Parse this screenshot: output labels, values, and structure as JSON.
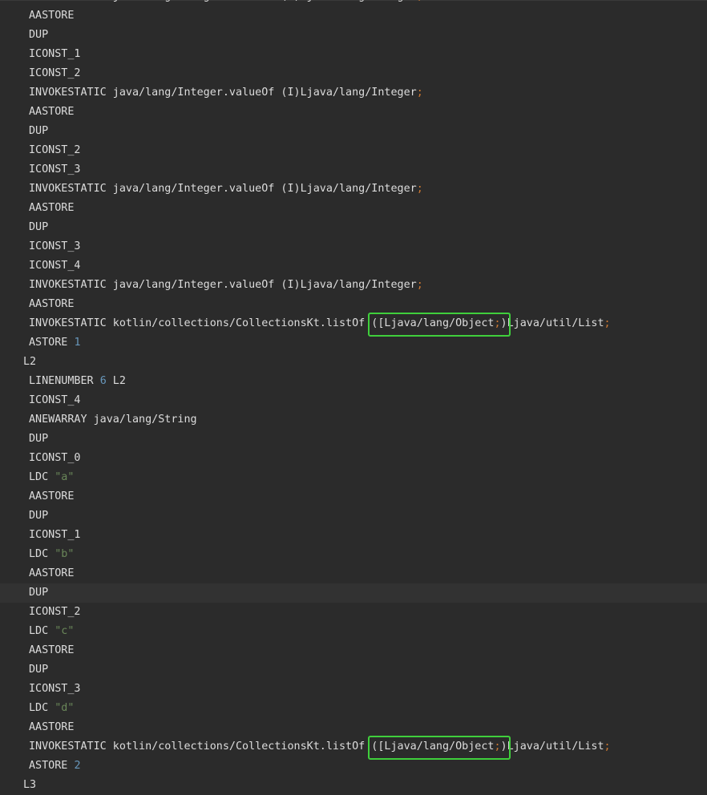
{
  "colors": {
    "background": "#2b2b2b",
    "text": "#dcdcdc",
    "number": "#6897bb",
    "string": "#6a8759",
    "semicolon": "#cc7832",
    "highlight_box": "#3fcf3c",
    "current_line": "#323232"
  },
  "code": {
    "lines": [
      {
        "kind": "insn",
        "tokens": [
          {
            "t": "plain",
            "v": "INVOKESTATIC java/lang/Integer.valueOf (I)Ljava/lang/Integer"
          },
          {
            "t": "semi",
            "v": ";"
          }
        ]
      },
      {
        "kind": "insn",
        "tokens": [
          {
            "t": "plain",
            "v": "AASTORE"
          }
        ]
      },
      {
        "kind": "insn",
        "tokens": [
          {
            "t": "plain",
            "v": "DUP"
          }
        ]
      },
      {
        "kind": "insn",
        "tokens": [
          {
            "t": "plain",
            "v": "ICONST_1"
          }
        ]
      },
      {
        "kind": "insn",
        "tokens": [
          {
            "t": "plain",
            "v": "ICONST_2"
          }
        ]
      },
      {
        "kind": "insn",
        "tokens": [
          {
            "t": "plain",
            "v": "INVOKESTATIC java/lang/Integer.valueOf (I)Ljava/lang/Integer"
          },
          {
            "t": "semi",
            "v": ";"
          }
        ]
      },
      {
        "kind": "insn",
        "tokens": [
          {
            "t": "plain",
            "v": "AASTORE"
          }
        ]
      },
      {
        "kind": "insn",
        "tokens": [
          {
            "t": "plain",
            "v": "DUP"
          }
        ]
      },
      {
        "kind": "insn",
        "tokens": [
          {
            "t": "plain",
            "v": "ICONST_2"
          }
        ]
      },
      {
        "kind": "insn",
        "tokens": [
          {
            "t": "plain",
            "v": "ICONST_3"
          }
        ]
      },
      {
        "kind": "insn",
        "tokens": [
          {
            "t": "plain",
            "v": "INVOKESTATIC java/lang/Integer.valueOf (I)Ljava/lang/Integer"
          },
          {
            "t": "semi",
            "v": ";"
          }
        ]
      },
      {
        "kind": "insn",
        "tokens": [
          {
            "t": "plain",
            "v": "AASTORE"
          }
        ]
      },
      {
        "kind": "insn",
        "tokens": [
          {
            "t": "plain",
            "v": "DUP"
          }
        ]
      },
      {
        "kind": "insn",
        "tokens": [
          {
            "t": "plain",
            "v": "ICONST_3"
          }
        ]
      },
      {
        "kind": "insn",
        "tokens": [
          {
            "t": "plain",
            "v": "ICONST_4"
          }
        ]
      },
      {
        "kind": "insn",
        "tokens": [
          {
            "t": "plain",
            "v": "INVOKESTATIC java/lang/Integer.valueOf (I)Ljava/lang/Integer"
          },
          {
            "t": "semi",
            "v": ";"
          }
        ]
      },
      {
        "kind": "insn",
        "tokens": [
          {
            "t": "plain",
            "v": "AASTORE"
          }
        ]
      },
      {
        "kind": "insn",
        "highlight": true,
        "tokens": [
          {
            "t": "plain",
            "v": "INVOKESTATIC kotlin/collections/CollectionsKt.listOf "
          },
          {
            "t": "boxstart",
            "v": "([Ljava/lang/Object"
          },
          {
            "t": "semi",
            "v": ";"
          },
          {
            "t": "boxend",
            "v": ")"
          },
          {
            "t": "plain",
            "v": "Ljava/util/List"
          },
          {
            "t": "semi",
            "v": ";"
          }
        ]
      },
      {
        "kind": "insn",
        "tokens": [
          {
            "t": "plain",
            "v": "ASTORE "
          },
          {
            "t": "num",
            "v": "1"
          }
        ]
      },
      {
        "kind": "label",
        "tokens": [
          {
            "t": "plain",
            "v": "L2"
          }
        ]
      },
      {
        "kind": "insn",
        "tokens": [
          {
            "t": "plain",
            "v": "LINENUMBER "
          },
          {
            "t": "num",
            "v": "6"
          },
          {
            "t": "plain",
            "v": " L2"
          }
        ]
      },
      {
        "kind": "insn",
        "tokens": [
          {
            "t": "plain",
            "v": "ICONST_4"
          }
        ]
      },
      {
        "kind": "insn",
        "tokens": [
          {
            "t": "plain",
            "v": "ANEWARRAY java/lang/String"
          }
        ]
      },
      {
        "kind": "insn",
        "tokens": [
          {
            "t": "plain",
            "v": "DUP"
          }
        ]
      },
      {
        "kind": "insn",
        "tokens": [
          {
            "t": "plain",
            "v": "ICONST_0"
          }
        ]
      },
      {
        "kind": "insn",
        "tokens": [
          {
            "t": "plain",
            "v": "LDC "
          },
          {
            "t": "str",
            "v": "\"a\""
          }
        ]
      },
      {
        "kind": "insn",
        "tokens": [
          {
            "t": "plain",
            "v": "AASTORE"
          }
        ]
      },
      {
        "kind": "insn",
        "tokens": [
          {
            "t": "plain",
            "v": "DUP"
          }
        ]
      },
      {
        "kind": "insn",
        "tokens": [
          {
            "t": "plain",
            "v": "ICONST_1"
          }
        ]
      },
      {
        "kind": "insn",
        "tokens": [
          {
            "t": "plain",
            "v": "LDC "
          },
          {
            "t": "str",
            "v": "\"b\""
          }
        ]
      },
      {
        "kind": "insn",
        "tokens": [
          {
            "t": "plain",
            "v": "AASTORE"
          }
        ]
      },
      {
        "kind": "insn",
        "current": true,
        "tokens": [
          {
            "t": "plain",
            "v": "DUP"
          }
        ]
      },
      {
        "kind": "insn",
        "tokens": [
          {
            "t": "plain",
            "v": "ICONST_2"
          }
        ]
      },
      {
        "kind": "insn",
        "tokens": [
          {
            "t": "plain",
            "v": "LDC "
          },
          {
            "t": "str",
            "v": "\"c\""
          }
        ]
      },
      {
        "kind": "insn",
        "tokens": [
          {
            "t": "plain",
            "v": "AASTORE"
          }
        ]
      },
      {
        "kind": "insn",
        "tokens": [
          {
            "t": "plain",
            "v": "DUP"
          }
        ]
      },
      {
        "kind": "insn",
        "tokens": [
          {
            "t": "plain",
            "v": "ICONST_3"
          }
        ]
      },
      {
        "kind": "insn",
        "tokens": [
          {
            "t": "plain",
            "v": "LDC "
          },
          {
            "t": "str",
            "v": "\"d\""
          }
        ]
      },
      {
        "kind": "insn",
        "tokens": [
          {
            "t": "plain",
            "v": "AASTORE"
          }
        ]
      },
      {
        "kind": "insn",
        "highlight": true,
        "tokens": [
          {
            "t": "plain",
            "v": "INVOKESTATIC kotlin/collections/CollectionsKt.listOf "
          },
          {
            "t": "boxstart",
            "v": "([Ljava/lang/Object"
          },
          {
            "t": "semi",
            "v": ";"
          },
          {
            "t": "boxend",
            "v": ")"
          },
          {
            "t": "plain",
            "v": "Ljava/util/List"
          },
          {
            "t": "semi",
            "v": ";"
          }
        ]
      },
      {
        "kind": "insn",
        "tokens": [
          {
            "t": "plain",
            "v": "ASTORE "
          },
          {
            "t": "num",
            "v": "2"
          }
        ]
      },
      {
        "kind": "label",
        "tokens": [
          {
            "t": "plain",
            "v": "L3"
          }
        ]
      }
    ]
  }
}
